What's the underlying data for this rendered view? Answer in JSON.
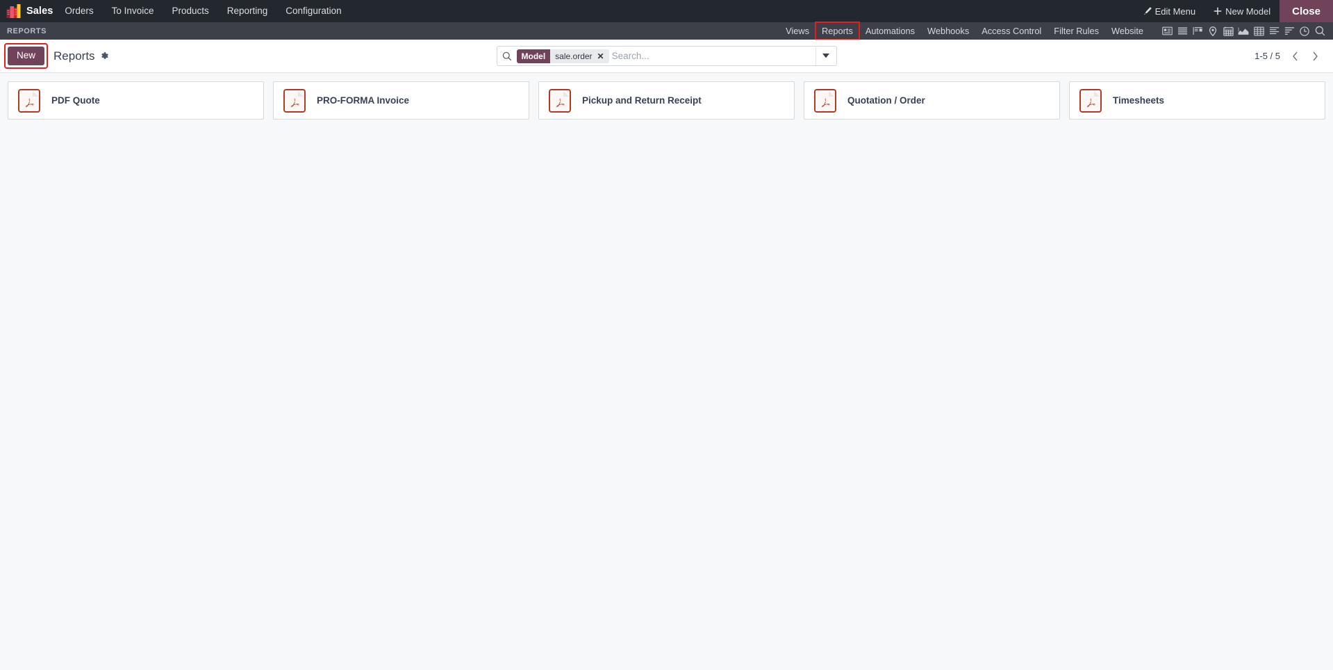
{
  "navbar": {
    "app_icon": "sales-app-icon",
    "app_name": "Sales",
    "menu_items": [
      {
        "label": "Orders"
      },
      {
        "label": "To Invoice"
      },
      {
        "label": "Products"
      },
      {
        "label": "Reporting"
      },
      {
        "label": "Configuration"
      }
    ],
    "edit_menu_label": "Edit Menu",
    "edit_menu_icon": "pencil-icon",
    "new_model_label": "New Model",
    "new_model_icon": "plus-icon",
    "close_label": "Close"
  },
  "studio": {
    "title": "REPORTS",
    "tabs": [
      {
        "label": "Views",
        "highlighted": false
      },
      {
        "label": "Reports",
        "highlighted": true
      },
      {
        "label": "Automations",
        "highlighted": false
      },
      {
        "label": "Webhooks",
        "highlighted": false
      },
      {
        "label": "Access Control",
        "highlighted": false
      },
      {
        "label": "Filter Rules",
        "highlighted": false
      },
      {
        "label": "Website",
        "highlighted": false
      }
    ],
    "view_icons": [
      {
        "name": "kanban-view-icon"
      },
      {
        "name": "list-view-icon"
      },
      {
        "name": "dashboard-view-icon"
      },
      {
        "name": "map-view-icon"
      },
      {
        "name": "calendar-view-icon"
      },
      {
        "name": "graph-view-icon"
      },
      {
        "name": "pivot-view-icon"
      },
      {
        "name": "form-view-icon"
      },
      {
        "name": "gantt-view-icon"
      },
      {
        "name": "activity-view-icon"
      },
      {
        "name": "search-view-icon"
      }
    ]
  },
  "control_panel": {
    "new_label": "New",
    "breadcrumb_title": "Reports",
    "gear_icon": "gear-icon",
    "highlight_color": "#e81c1c",
    "accent_color": "#71435b"
  },
  "search": {
    "icon": "search-icon",
    "facet_label": "Model",
    "facet_value": "sale.order",
    "facet_remove_icon": "close-icon",
    "placeholder": "Search...",
    "value": "",
    "dropdown_icon": "caret-down-icon"
  },
  "pager": {
    "range": "1-5 / 5",
    "previous_icon": "chevron-left-icon",
    "next_icon": "chevron-right-icon"
  },
  "reports": {
    "items": [
      {
        "name": "PDF Quote",
        "icon": "pdf-file-icon"
      },
      {
        "name": "PRO-FORMA Invoice",
        "icon": "pdf-file-icon"
      },
      {
        "name": "Pickup and Return Receipt",
        "icon": "pdf-file-icon"
      },
      {
        "name": "Quotation / Order",
        "icon": "pdf-file-icon"
      },
      {
        "name": "Timesheets",
        "icon": "pdf-file-icon"
      }
    ]
  }
}
